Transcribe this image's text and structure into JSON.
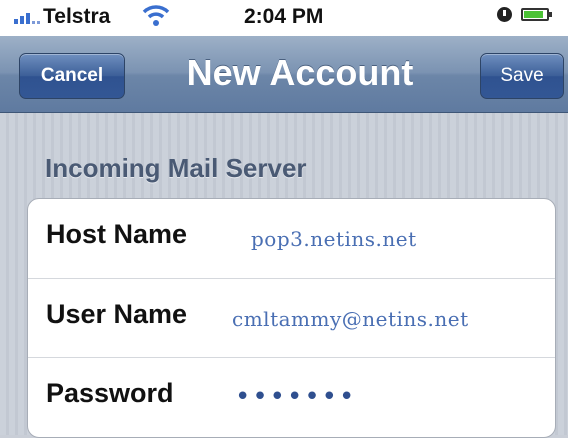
{
  "status_bar": {
    "carrier": "Telstra",
    "time": "2:04 PM",
    "icons": [
      "signal-icon",
      "wifi-icon",
      "alarm-icon",
      "battery-icon"
    ]
  },
  "nav": {
    "title": "New Account",
    "cancel_label": "Cancel",
    "save_label": "Save"
  },
  "section": {
    "header": "Incoming Mail Server",
    "rows": [
      {
        "label": "Host Name",
        "value": "pop3.netins.net"
      },
      {
        "label": "User Name",
        "value": "cmltammy@netins.net"
      },
      {
        "label": "Password",
        "value": "•••••••"
      }
    ]
  },
  "colors": {
    "nav_bar": "#7b93b2",
    "button": "#3c5f98",
    "value_text": "#4a6fb3",
    "section_header": "#4a5a74"
  }
}
